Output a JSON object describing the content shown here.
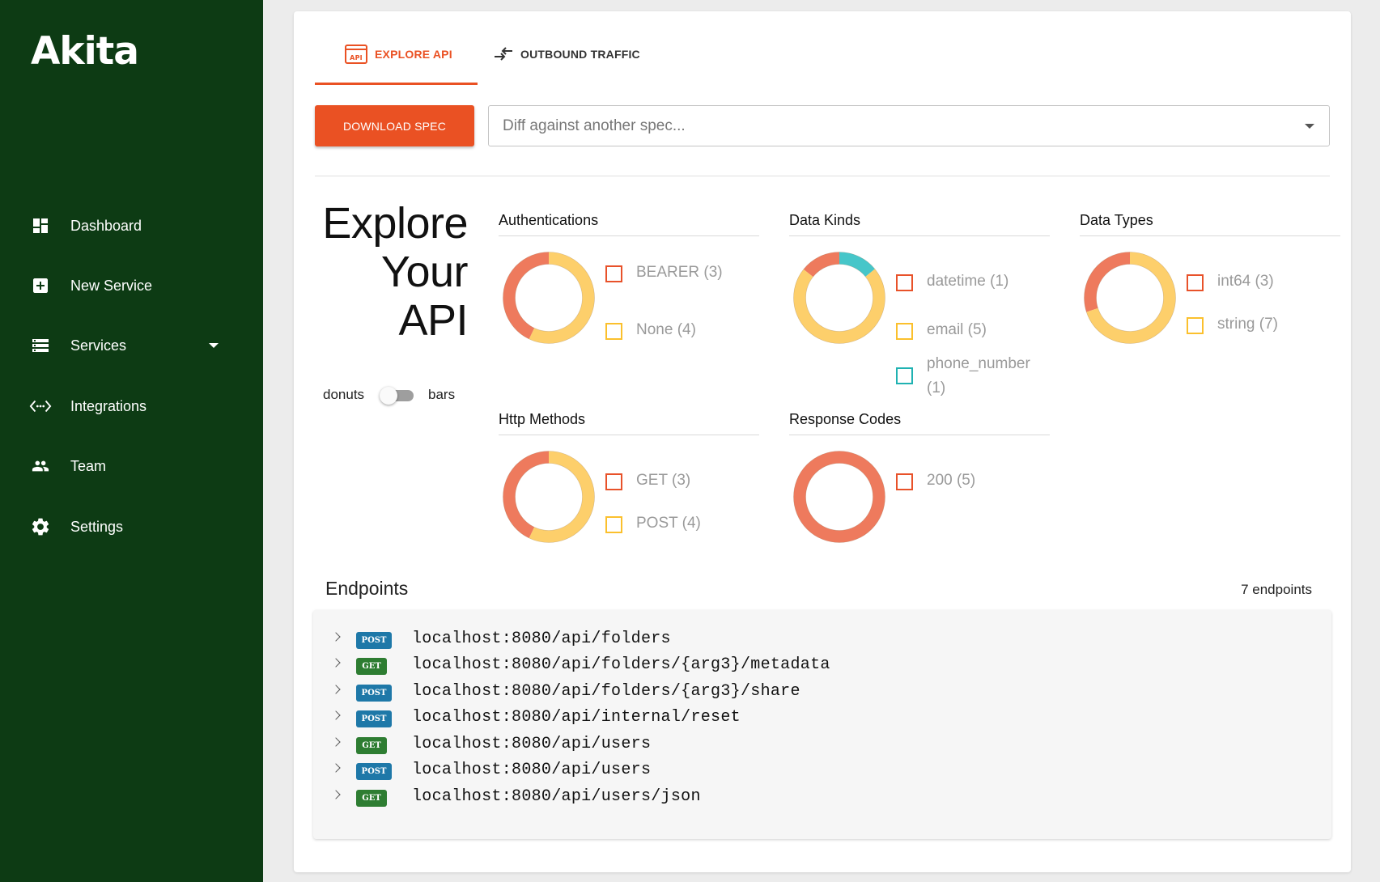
{
  "app": {
    "logo": "Akita"
  },
  "sidebar": {
    "items": [
      {
        "label": "Dashboard",
        "icon": "dashboard-icon"
      },
      {
        "label": "New Service",
        "icon": "add-box-icon"
      },
      {
        "label": "Services",
        "icon": "storage-icon",
        "has_dropdown": true
      },
      {
        "label": "Integrations",
        "icon": "code-icon"
      },
      {
        "label": "Team",
        "icon": "people-icon"
      },
      {
        "label": "Settings",
        "icon": "gear-icon"
      }
    ]
  },
  "tabs": [
    {
      "label": "EXPLORE API",
      "icon": "api-icon",
      "active": true
    },
    {
      "label": "OUTBOUND TRAFFIC",
      "icon": "swap-arrows-icon",
      "active": false
    }
  ],
  "toolbar": {
    "download_label": "DOWNLOAD SPEC",
    "diff_placeholder": "Diff against another spec..."
  },
  "explore": {
    "title_lines": [
      "Explore",
      "Your",
      "API"
    ],
    "toggle_left": "donuts",
    "toggle_right": "bars",
    "toggle_on": false
  },
  "colors": {
    "brand_orange": "#ea5123",
    "sidebar_green": "#0d3b14",
    "donut_red": "#ee7a5d",
    "donut_yellow": "#fdcf6b",
    "donut_teal": "#46c6c9",
    "legend_red": "#e8522a",
    "legend_yellow": "#fbc02d",
    "legend_teal": "#20b2b2",
    "badge_post": "#1e78a8",
    "badge_get": "#2e7d32"
  },
  "chart_data": [
    {
      "type": "pie",
      "title": "Authentications",
      "categories": [
        "BEARER",
        "None"
      ],
      "values": [
        3,
        4
      ],
      "labels": [
        "BEARER (3)",
        "None (4)"
      ],
      "colors": [
        "#ee7a5d",
        "#fdcf6b"
      ],
      "legend_colors": [
        "#e8522a",
        "#fbc02d"
      ]
    },
    {
      "type": "pie",
      "title": "Data Kinds",
      "categories": [
        "datetime",
        "email",
        "phone_number"
      ],
      "values": [
        1,
        5,
        1
      ],
      "labels": [
        "datetime (1)",
        "email (5)",
        "phone_number (1)"
      ],
      "colors": [
        "#ee7a5d",
        "#fdcf6b",
        "#46c6c9"
      ],
      "legend_colors": [
        "#e8522a",
        "#fbc02d",
        "#20b2b2"
      ]
    },
    {
      "type": "pie",
      "title": "Data Types",
      "categories": [
        "int64",
        "string"
      ],
      "values": [
        3,
        7
      ],
      "labels": [
        "int64 (3)",
        "string (7)"
      ],
      "colors": [
        "#ee7a5d",
        "#fdcf6b"
      ],
      "legend_colors": [
        "#e8522a",
        "#fbc02d"
      ]
    },
    {
      "type": "pie",
      "title": "Http Methods",
      "categories": [
        "GET",
        "POST"
      ],
      "values": [
        3,
        4
      ],
      "labels": [
        "GET (3)",
        "POST (4)"
      ],
      "colors": [
        "#ee7a5d",
        "#fdcf6b"
      ],
      "legend_colors": [
        "#e8522a",
        "#fbc02d"
      ]
    },
    {
      "type": "pie",
      "title": "Response Codes",
      "categories": [
        "200"
      ],
      "values": [
        5
      ],
      "labels": [
        "200 (5)"
      ],
      "colors": [
        "#ee7a5d"
      ],
      "legend_colors": [
        "#e8522a"
      ]
    }
  ],
  "endpoints": {
    "title": "Endpoints",
    "count_label": "7 endpoints",
    "rows": [
      {
        "method": "POST",
        "path": "localhost:8080/api/folders"
      },
      {
        "method": "GET",
        "path": "localhost:8080/api/folders/{arg3}/metadata"
      },
      {
        "method": "POST",
        "path": "localhost:8080/api/folders/{arg3}/share"
      },
      {
        "method": "POST",
        "path": "localhost:8080/api/internal/reset"
      },
      {
        "method": "GET",
        "path": "localhost:8080/api/users"
      },
      {
        "method": "POST",
        "path": "localhost:8080/api/users"
      },
      {
        "method": "GET",
        "path": "localhost:8080/api/users/json"
      }
    ]
  }
}
